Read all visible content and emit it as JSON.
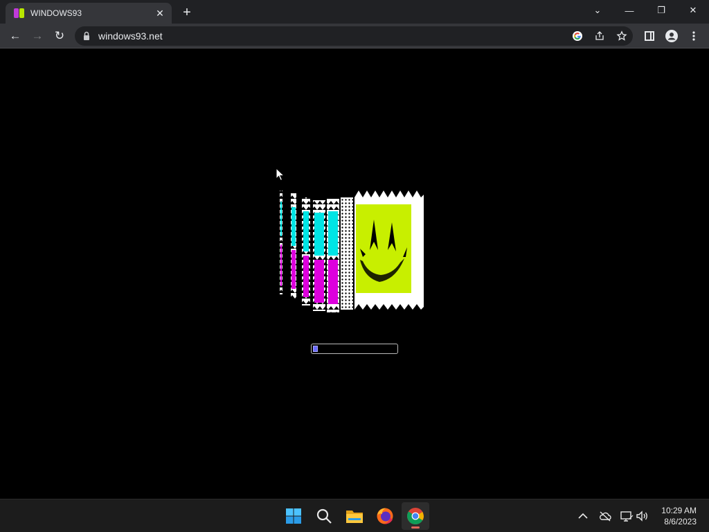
{
  "browser": {
    "tab": {
      "title": "WINDOWS93",
      "close_glyph": "✕"
    },
    "new_tab_glyph": "+",
    "window_controls": {
      "tab_search": "⌄",
      "minimize": "—",
      "restore": "❐",
      "close": "✕"
    },
    "nav": {
      "back": "←",
      "forward": "→",
      "reload": "↻"
    },
    "address": {
      "url": "windows93.net"
    },
    "toolbar_icons": [
      "google-icon",
      "share-icon",
      "star-icon",
      "side-panel-icon",
      "profile-icon",
      "menu-icon"
    ]
  },
  "page": {
    "loading_progress": 0.06,
    "colors": {
      "cyan": "#00e5e5",
      "magenta": "#dd00dd",
      "lime": "#c8ef00",
      "progress": "#6a6aff"
    }
  },
  "taskbar": {
    "apps": [
      "start-icon",
      "search-icon",
      "file-explorer-icon",
      "firefox-icon",
      "chrome-icon"
    ],
    "active_app": "chrome-icon",
    "clock": {
      "time": "10:29 AM",
      "date": "8/6/2023"
    }
  }
}
